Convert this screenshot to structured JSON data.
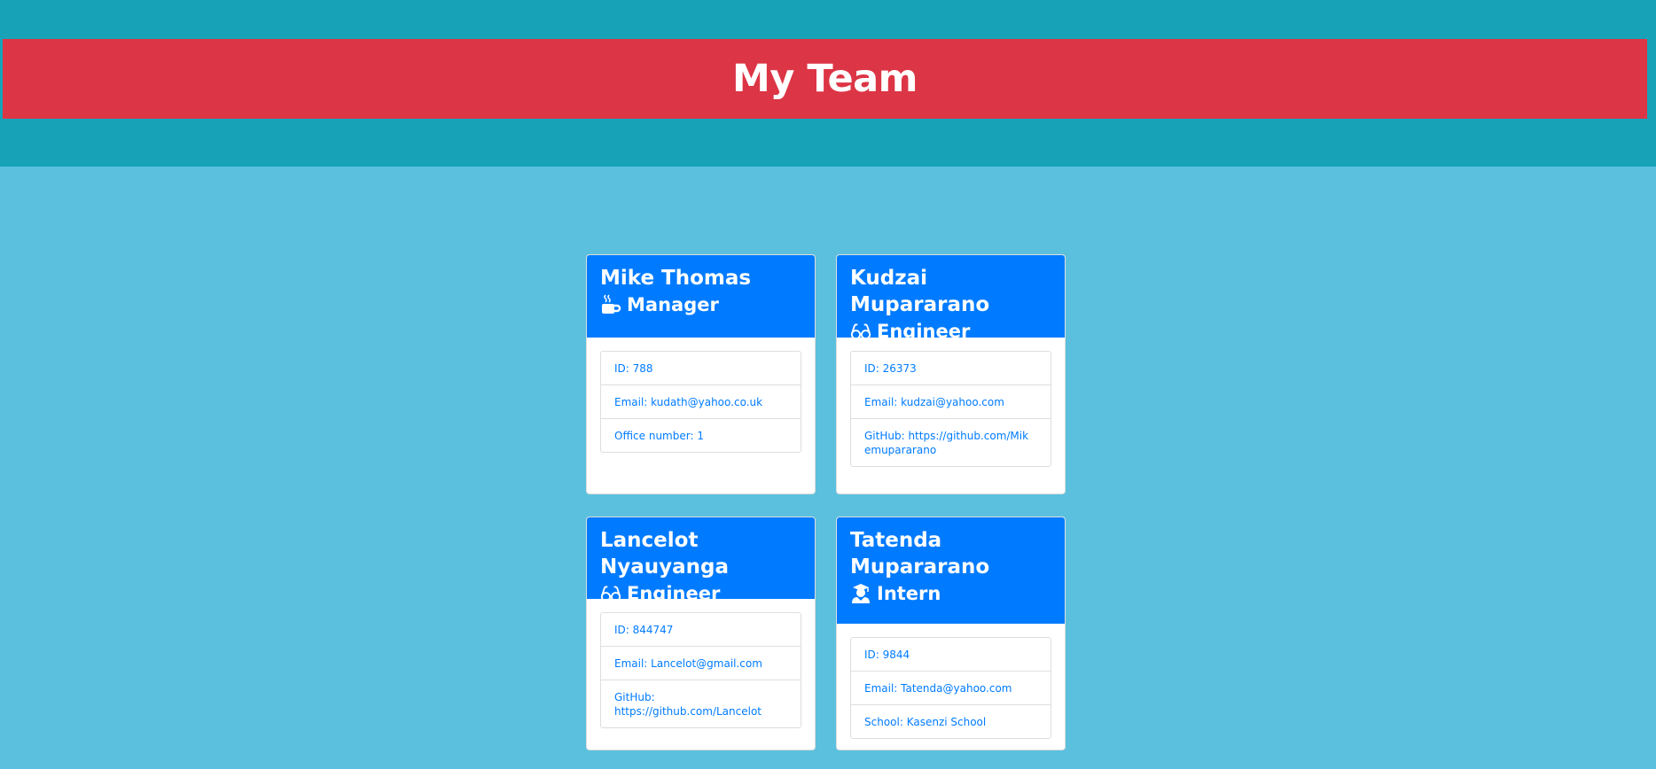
{
  "header": {
    "title": "My Team"
  },
  "employees": [
    {
      "name": "Mike Thomas",
      "role": "Manager",
      "role_icon": "coffee-icon",
      "details": [
        "ID: 788",
        "Email: kudath@yahoo.co.uk",
        "Office number: 1"
      ]
    },
    {
      "name": "Kudzai Mupararano",
      "role": "Engineer",
      "role_icon": "glasses-icon",
      "details": [
        "ID: 26373",
        "Email: kudzai@yahoo.com",
        "GitHub: https://github.com/Mikemupararano"
      ]
    },
    {
      "name": "Lancelot Nyauyanga",
      "role": "Engineer",
      "role_icon": "glasses-icon",
      "details": [
        "ID: 844747",
        "Email: Lancelot@gmail.com",
        "GitHub: https://github.com/Lancelot"
      ]
    },
    {
      "name": "Tatenda Mupararano",
      "role": "Intern",
      "role_icon": "user-graduate-icon",
      "details": [
        "ID: 9844",
        "Email: Tatenda@yahoo.com",
        "School: Kasenzi School"
      ]
    }
  ],
  "colors": {
    "page_bg": "#5bc0de",
    "top_band": "#17a2b8",
    "header_bar": "#dc3545",
    "card_header": "#007bff",
    "link_text": "#007bff"
  }
}
